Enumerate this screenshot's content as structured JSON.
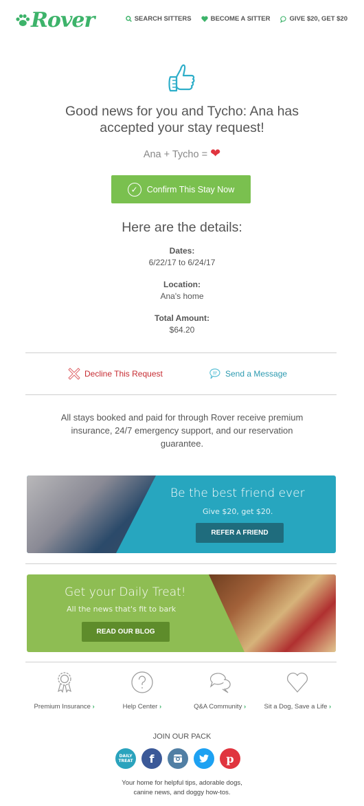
{
  "header": {
    "logo": "Rover",
    "nav": [
      {
        "label": "SEARCH SITTERS",
        "icon": "search-icon"
      },
      {
        "label": "BECOME A SITTER",
        "icon": "heart-icon"
      },
      {
        "label": "GIVE $20, GET $20",
        "icon": "chat-bubble-icon"
      }
    ]
  },
  "hero": {
    "icon": "thumbs-up-icon",
    "headline_line1": "Good news for you and Tycho: Ana has",
    "headline_line2": "accepted your stay request!",
    "equation": "Ana + Tycho =",
    "equation_icon": "heart-icon"
  },
  "confirm_button": {
    "label": "Confirm This Stay Now",
    "icon": "check-circle-icon"
  },
  "details": {
    "title": "Here are the details:",
    "items": [
      {
        "label": "Dates:",
        "value": "6/22/17 to 6/24/17"
      },
      {
        "label": "Location:",
        "value": "Ana's home"
      },
      {
        "label": "Total Amount:",
        "value": "$64.20"
      }
    ]
  },
  "actions": {
    "decline": "Decline This Request",
    "message": "Send a Message"
  },
  "insurance_text": {
    "line1": "All stays booked and paid for through Rover receive premium",
    "line2": "insurance, 24/7 emergency support, and our reservation",
    "line3": "guarantee."
  },
  "banners": {
    "referral": {
      "title": "Be the best friend ever",
      "subtitle": "Give $20, get $20.",
      "button": "REFER A FRIEND",
      "color": "#27a6bf"
    },
    "blog": {
      "title": "Get your Daily Treat!",
      "subtitle": "All the news that's fit to bark",
      "button": "READ OUR BLOG",
      "color": "#8ebd53"
    }
  },
  "footer_links": [
    {
      "label": "Premium Insurance",
      "icon": "award-ribbon-icon"
    },
    {
      "label": "Help Center",
      "icon": "question-circle-icon"
    },
    {
      "label": "Q&A Community",
      "icon": "chat-bubbles-icon"
    },
    {
      "label": "Sit a Dog, Save a Life",
      "icon": "heart-outline-icon"
    }
  ],
  "social": {
    "title": "JOIN OUR PACK",
    "items": [
      {
        "name": "daily-treat",
        "glyph": "DAILY TREAT",
        "color": "#2aa3bd"
      },
      {
        "name": "facebook",
        "glyph": "f",
        "color": "#3b5998"
      },
      {
        "name": "instagram",
        "glyph": "◙",
        "color": "#517fa4"
      },
      {
        "name": "twitter",
        "glyph": "🐦",
        "color": "#1da1f2"
      },
      {
        "name": "pinterest",
        "glyph": "p",
        "color": "#e0353f"
      }
    ],
    "tagline_line1": "Your home for helpful tips, adorable dogs,",
    "tagline_line2": "canine news, and doggy how-tos."
  }
}
